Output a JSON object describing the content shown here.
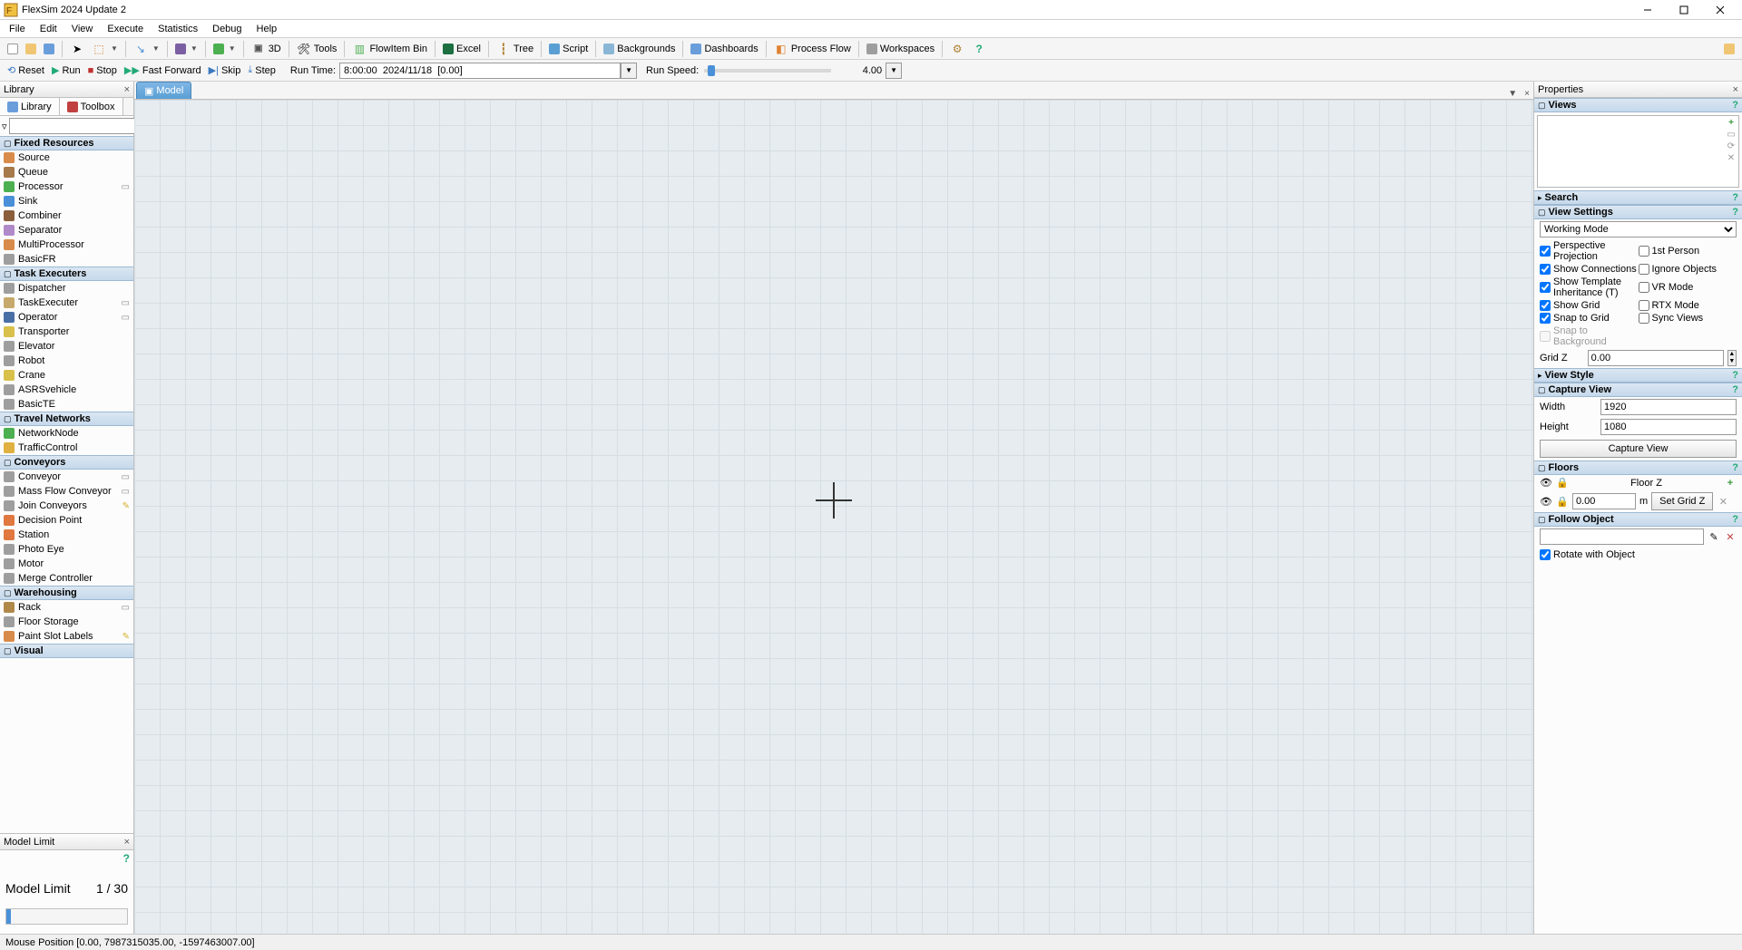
{
  "window": {
    "title": "FlexSim 2024 Update 2"
  },
  "menu": [
    "File",
    "Edit",
    "View",
    "Execute",
    "Statistics",
    "Debug",
    "Help"
  ],
  "toolbar1": {
    "items": [
      "3D",
      "Tools",
      "FlowItem Bin",
      "Excel",
      "Tree",
      "Script",
      "Backgrounds",
      "Dashboards",
      "Process Flow",
      "Workspaces"
    ]
  },
  "toolbar2": {
    "reset": "Reset",
    "run": "Run",
    "stop": "Stop",
    "ffwd": "Fast Forward",
    "skip": "Skip",
    "step": "Step",
    "runtime_label": "Run Time:",
    "runtime_value": "8:00:00  2024/11/18  [0.00]",
    "runspeed_label": "Run Speed:",
    "runspeed_value": "4.00"
  },
  "library": {
    "panel_title": "Library",
    "tabs": {
      "library": "Library",
      "toolbox": "Toolbox"
    },
    "groups": [
      {
        "title": "Fixed Resources",
        "items": [
          {
            "label": "Source",
            "icon": "#d88b4a"
          },
          {
            "label": "Queue",
            "icon": "#a67a4b"
          },
          {
            "label": "Processor",
            "icon": "#4caf50",
            "extra": true
          },
          {
            "label": "Sink",
            "icon": "#4a90d9"
          },
          {
            "label": "Combiner",
            "icon": "#8b5e3c"
          },
          {
            "label": "Separator",
            "icon": "#b089c9"
          },
          {
            "label": "MultiProcessor",
            "icon": "#d88b4a"
          },
          {
            "label": "BasicFR",
            "icon": "#9e9e9e"
          }
        ]
      },
      {
        "title": "Task Executers",
        "items": [
          {
            "label": "Dispatcher",
            "icon": "#9e9e9e"
          },
          {
            "label": "TaskExecuter",
            "icon": "#c6a96b",
            "extra": true
          },
          {
            "label": "Operator",
            "icon": "#4a6fa5",
            "extra": true
          },
          {
            "label": "Transporter",
            "icon": "#d8c04a"
          },
          {
            "label": "Elevator",
            "icon": "#9e9e9e"
          },
          {
            "label": "Robot",
            "icon": "#9e9e9e"
          },
          {
            "label": "Crane",
            "icon": "#d8c04a"
          },
          {
            "label": "ASRSvehicle",
            "icon": "#9e9e9e"
          },
          {
            "label": "BasicTE",
            "icon": "#9e9e9e"
          }
        ]
      },
      {
        "title": "Travel Networks",
        "items": [
          {
            "label": "NetworkNode",
            "icon": "#4caf50"
          },
          {
            "label": "TrafficControl",
            "icon": "#e0b040"
          }
        ]
      },
      {
        "title": "Conveyors",
        "items": [
          {
            "label": "Conveyor",
            "icon": "#9e9e9e",
            "extra": true
          },
          {
            "label": "Mass Flow Conveyor",
            "icon": "#9e9e9e",
            "extra": true
          },
          {
            "label": "Join Conveyors",
            "icon": "#9e9e9e",
            "pencil": true
          },
          {
            "label": "Decision Point",
            "icon": "#e07840"
          },
          {
            "label": "Station",
            "icon": "#e07840"
          },
          {
            "label": "Photo Eye",
            "icon": "#9e9e9e"
          },
          {
            "label": "Motor",
            "icon": "#9e9e9e"
          },
          {
            "label": "Merge Controller",
            "icon": "#9e9e9e"
          }
        ]
      },
      {
        "title": "Warehousing",
        "items": [
          {
            "label": "Rack",
            "icon": "#b0884a",
            "extra": true
          },
          {
            "label": "Floor Storage",
            "icon": "#9e9e9e"
          },
          {
            "label": "Paint Slot Labels",
            "icon": "#d88b4a",
            "pencil": true
          }
        ]
      }
    ],
    "partial_next": "Visual"
  },
  "model_limit": {
    "panel_title": "Model Limit",
    "label": "Model Limit",
    "value": "1 / 30"
  },
  "doc_tab": {
    "label": "Model"
  },
  "properties": {
    "panel_title": "Properties",
    "views": {
      "title": "Views"
    },
    "search": {
      "title": "Search"
    },
    "view_settings": {
      "title": "View Settings",
      "mode": "Working Mode",
      "checks_left": [
        "Perspective Projection",
        "Show Connections",
        "Show Template Inheritance (T)",
        "Show Grid",
        "Snap to Grid",
        "Snap to Background"
      ],
      "checks_right": [
        "1st Person",
        "Ignore Objects",
        "VR Mode",
        "RTX Mode",
        "Sync Views"
      ],
      "checked_left": [
        true,
        true,
        true,
        true,
        true,
        false
      ],
      "checked_right": [
        false,
        false,
        false,
        false,
        false
      ],
      "gridz_label": "Grid Z",
      "gridz_value": "0.00"
    },
    "view_style": {
      "title": "View Style"
    },
    "capture": {
      "title": "Capture View",
      "width_label": "Width",
      "width_value": "1920",
      "height_label": "Height",
      "height_value": "1080",
      "button": "Capture View"
    },
    "floors": {
      "title": "Floors",
      "col": "Floor Z",
      "value": "0.00",
      "unit": "m",
      "button": "Set Grid Z"
    },
    "follow": {
      "title": "Follow Object",
      "rotate": "Rotate with Object"
    }
  },
  "statusbar": {
    "text": "Mouse Position [0.00, 7987315035.00, -1597463007.00]"
  }
}
